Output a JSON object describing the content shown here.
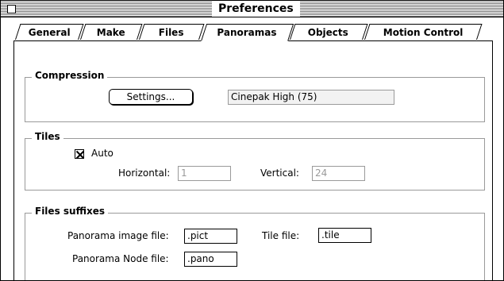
{
  "window": {
    "title": "Preferences"
  },
  "tabs": [
    {
      "label": "General",
      "active": false
    },
    {
      "label": "Make",
      "active": false
    },
    {
      "label": "Files",
      "active": false
    },
    {
      "label": "Panoramas",
      "active": true
    },
    {
      "label": "Objects",
      "active": false
    },
    {
      "label": "Motion Control",
      "active": false
    }
  ],
  "compression": {
    "title": "Compression",
    "settings_button": "Settings...",
    "codec_value": "Cinepak High (75)"
  },
  "tiles": {
    "title": "Tiles",
    "auto_label": "Auto",
    "auto_checked": true,
    "horizontal_label": "Horizontal:",
    "horizontal_value": "1",
    "vertical_label": "Vertical:",
    "vertical_value": "24"
  },
  "file_suffixes": {
    "title": "Files suffixes",
    "panorama_image_label": "Panorama image file:",
    "panorama_image_value": ".pict",
    "tile_label": "Tile file:",
    "tile_value": ".tile",
    "panorama_node_label": "Panorama Node file:",
    "panorama_node_value": ".pano"
  }
}
